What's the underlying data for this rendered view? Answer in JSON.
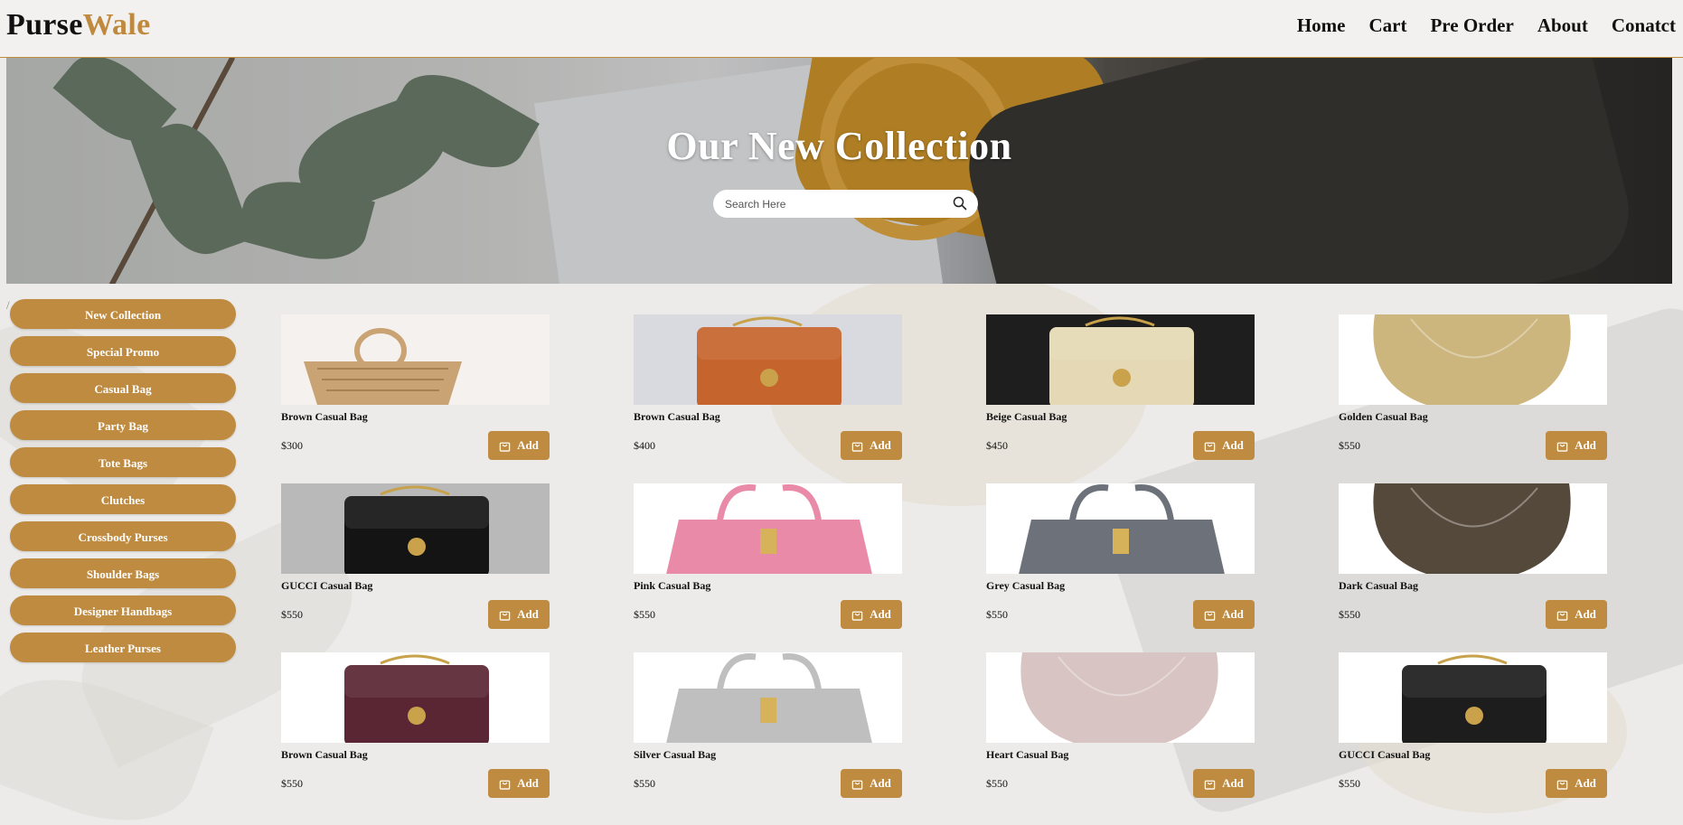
{
  "brand": {
    "part1": "Purse",
    "part2": "Wale"
  },
  "nav": [
    "Home",
    "Cart",
    "Pre Order",
    "About",
    "Conatct"
  ],
  "hero": {
    "title": "Our New Collection",
    "search_placeholder": "Search Here"
  },
  "breadcrumb_mark": "/",
  "categories": [
    "New Collection",
    "Special Promo",
    "Casual Bag",
    "Party Bag",
    "Tote Bags",
    "Clutches",
    "Crossbody Purses",
    "Shoulder Bags",
    "Designer Handbags",
    "Leather Purses"
  ],
  "add_label": "Add",
  "products": [
    {
      "name": "Brown Casual Bag",
      "price": "$300",
      "color": "#c9a373",
      "bg": "#f4f1ee",
      "style": "woven"
    },
    {
      "name": "Brown Casual Bag",
      "price": "$400",
      "color": "#c6642d",
      "bg": "#d9dadf",
      "style": "box"
    },
    {
      "name": "Beige Casual Bag",
      "price": "$450",
      "color": "#e4d9b4",
      "bg": "#1e1e1e",
      "style": "box"
    },
    {
      "name": "Golden Casual Bag",
      "price": "$550",
      "color": "#cdb57e",
      "bg": "#ffffff",
      "style": "round"
    },
    {
      "name": "GUCCI Casual Bag",
      "price": "$550",
      "color": "#141414",
      "bg": "#b9b9b9",
      "style": "box"
    },
    {
      "name": "Pink Casual Bag",
      "price": "$550",
      "color": "#e98aa9",
      "bg": "#ffffff",
      "style": "handbag"
    },
    {
      "name": "Grey Casual Bag",
      "price": "$550",
      "color": "#6d7179",
      "bg": "#ffffff",
      "style": "handbag"
    },
    {
      "name": "Dark Casual Bag",
      "price": "$550",
      "color": "#55493b",
      "bg": "#ffffff",
      "style": "round"
    },
    {
      "name": "Brown Casual Bag",
      "price": "$550",
      "color": "#5a2634",
      "bg": "#ffffff",
      "style": "box"
    },
    {
      "name": "Silver Casual Bag",
      "price": "$550",
      "color": "#bfbfbf",
      "bg": "#ffffff",
      "style": "handbag"
    },
    {
      "name": "Heart Casual Bag",
      "price": "$550",
      "color": "#d8c4c3",
      "bg": "#ffffff",
      "style": "round"
    },
    {
      "name": "GUCCI Casual Bag",
      "price": "$550",
      "color": "#1d1d1d",
      "bg": "#ffffff",
      "style": "box"
    }
  ],
  "colors": {
    "accent": "#bf8b41",
    "text": "#111111"
  },
  "icons": {
    "search": "search-icon",
    "bag": "shopping-bag-icon"
  }
}
